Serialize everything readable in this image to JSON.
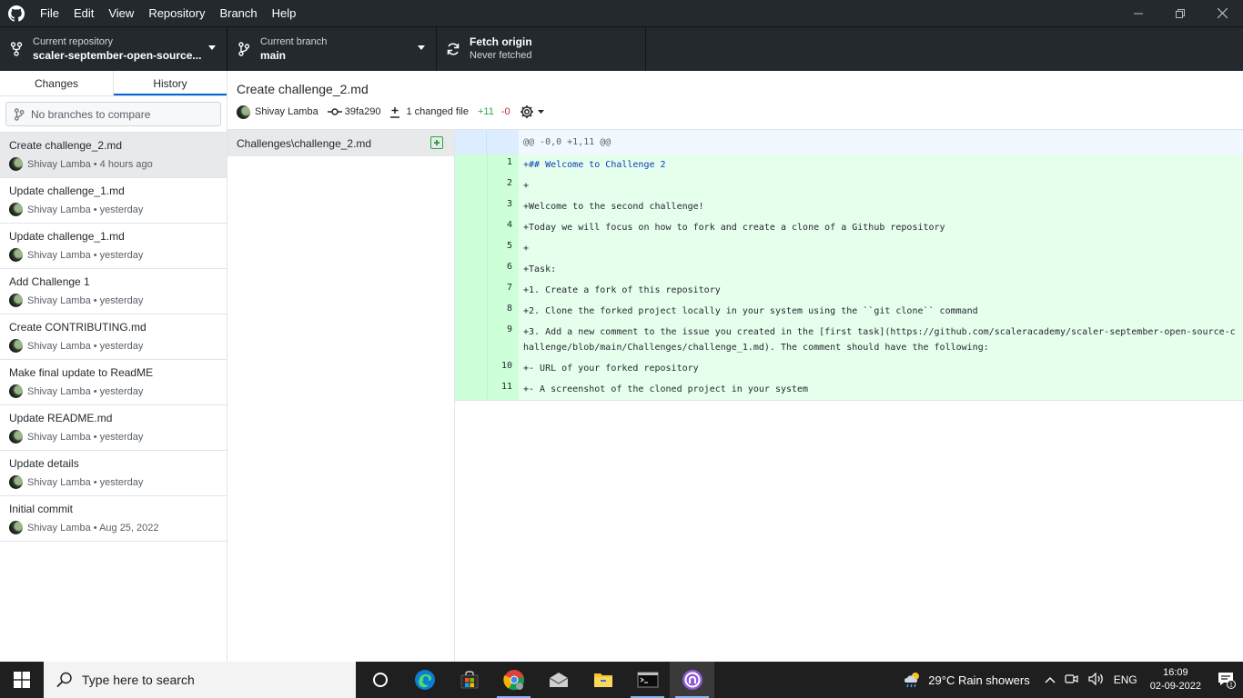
{
  "menu": [
    "File",
    "Edit",
    "View",
    "Repository",
    "Branch",
    "Help"
  ],
  "toolbar": {
    "repo_label": "Current repository",
    "repo_value": "scaler-september-open-source...",
    "branch_label": "Current branch",
    "branch_value": "main",
    "fetch_label": "Fetch origin",
    "fetch_value": "Never fetched"
  },
  "sidebar": {
    "tabs": [
      "Changes",
      "History"
    ],
    "active_tab": "History",
    "compare_placeholder": "No branches to compare",
    "commits": [
      {
        "title": "Create challenge_2.md",
        "meta": "Shivay Lamba • 4 hours ago"
      },
      {
        "title": "Update challenge_1.md",
        "meta": "Shivay Lamba • yesterday"
      },
      {
        "title": "Update challenge_1.md",
        "meta": "Shivay Lamba • yesterday"
      },
      {
        "title": "Add Challenge 1",
        "meta": "Shivay Lamba • yesterday"
      },
      {
        "title": "Create CONTRIBUTING.md",
        "meta": "Shivay Lamba • yesterday"
      },
      {
        "title": "Make final update to ReadME",
        "meta": "Shivay Lamba • yesterday"
      },
      {
        "title": "Update README.md",
        "meta": "Shivay Lamba • yesterday"
      },
      {
        "title": "Update details",
        "meta": "Shivay Lamba • yesterday"
      },
      {
        "title": "Initial commit",
        "meta": "Shivay Lamba • Aug 25, 2022"
      }
    ]
  },
  "commit": {
    "title": "Create challenge_2.md",
    "author": "Shivay Lamba",
    "sha": "39fa290",
    "changed_files": "1 changed file",
    "additions": "+11",
    "deletions": "-0"
  },
  "files": [
    {
      "path": "Challenges\\challenge_2.md",
      "status": "added"
    }
  ],
  "diff": {
    "hunk": "@@ -0,0 +1,11 @@",
    "lines": [
      {
        "num": "1",
        "text": "+## Welcome to Challenge 2"
      },
      {
        "num": "2",
        "text": "+"
      },
      {
        "num": "3",
        "text": "+Welcome to the second challenge!"
      },
      {
        "num": "4",
        "text": "+Today we will focus on how to fork and create a clone of a Github repository"
      },
      {
        "num": "5",
        "text": "+"
      },
      {
        "num": "6",
        "text": "+Task:"
      },
      {
        "num": "7",
        "text": "+1. Create a fork of this repository"
      },
      {
        "num": "8",
        "text": "+2. Clone the forked project locally in your system using the ``git clone`` command"
      },
      {
        "num": "9",
        "text": "+3. Add a new comment to the issue you created in the [first task](https://github.com/scaleracademy/scaler-september-open-source-challenge/blob/main/Challenges/challenge_1.md). The comment should have the following:"
      },
      {
        "num": "10",
        "text": "+- URL of your forked repository"
      },
      {
        "num": "11",
        "text": "+- A screenshot of the cloned project in your system"
      }
    ]
  },
  "taskbar": {
    "search_placeholder": "Type here to search",
    "weather": "29°C  Rain showers",
    "lang": "ENG",
    "time": "16:09",
    "date": "02-09-2022",
    "notification_count": "1"
  }
}
